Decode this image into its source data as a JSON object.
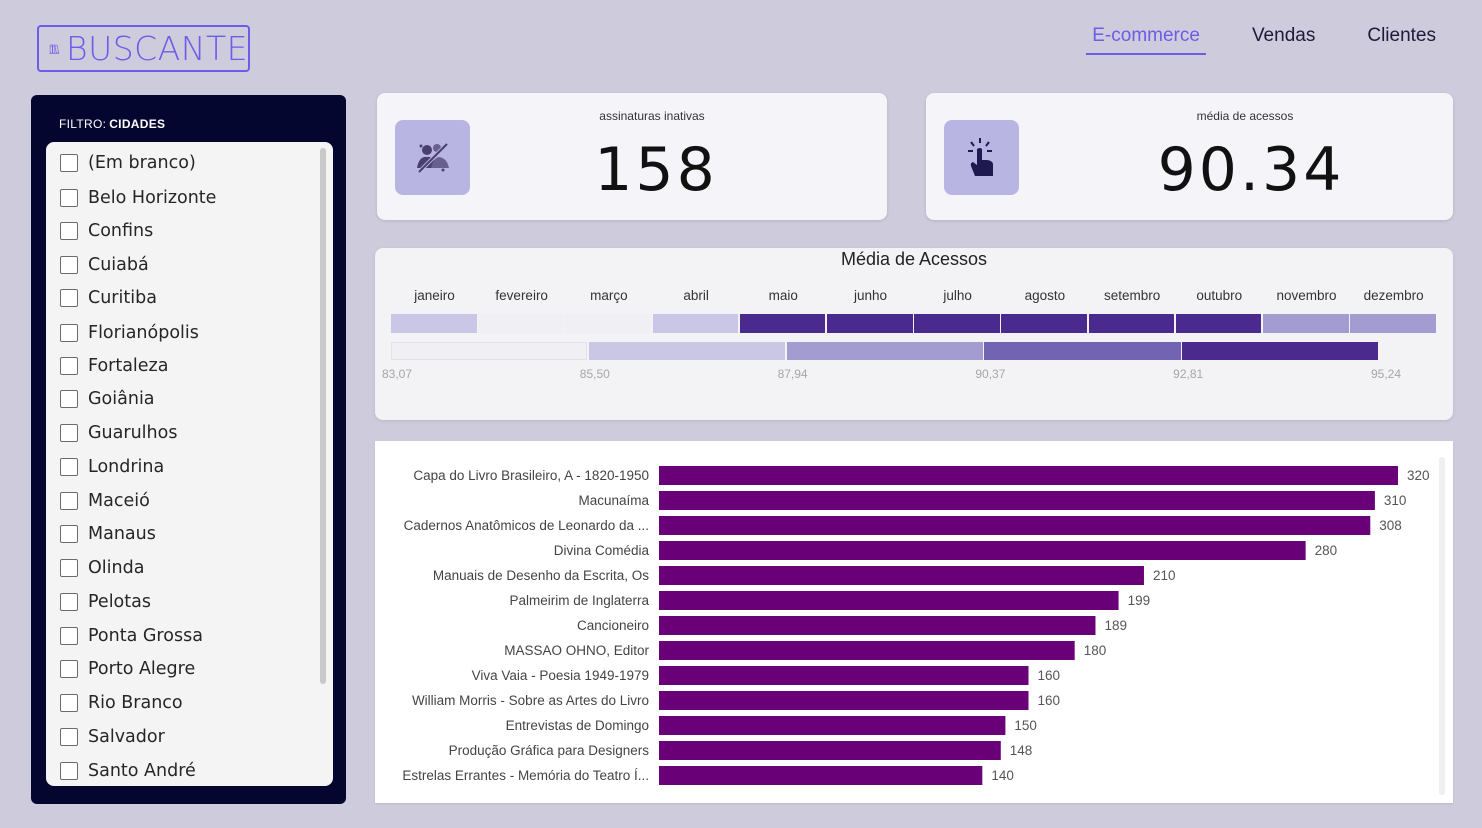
{
  "logo": {
    "text": "BUSCANTE",
    "icon": "books-icon"
  },
  "nav": {
    "items": [
      {
        "label": "E-commerce",
        "active": true
      },
      {
        "label": "Vendas",
        "active": false
      },
      {
        "label": "Clientes",
        "active": false
      }
    ]
  },
  "filter": {
    "prefix": "FILTRO:",
    "name": "CIDADES",
    "items": [
      "(Em branco)",
      "Belo Horizonte",
      "Confins",
      "Cuiabá",
      "Curitiba",
      "Florianópolis",
      "Fortaleza",
      "Goiânia",
      "Guarulhos",
      "Londrina",
      "Maceió",
      "Manaus",
      "Olinda",
      "Pelotas",
      "Ponta Grossa",
      "Porto Alegre",
      "Rio Branco",
      "Salvador",
      "Santo André"
    ]
  },
  "kpis": [
    {
      "label": "assinaturas inativas",
      "value": "158",
      "icon": "inactive-subscription-icon"
    },
    {
      "label": "média de acessos",
      "value": "90.34",
      "icon": "pointer-click-icon"
    }
  ],
  "heatmap": {
    "title": "Média de Acessos",
    "months": [
      "janeiro",
      "fevereiro",
      "março",
      "abril",
      "maio",
      "junho",
      "julho",
      "agosto",
      "setembro",
      "outubro",
      "novembro",
      "dezembro"
    ],
    "month_colors": [
      "#cac6e6",
      "#efeff4",
      "#efeff4",
      "#cac6e6",
      "#4a2a8f",
      "#4a2a8f",
      "#4a2a8f",
      "#4a2a8f",
      "#4a2a8f",
      "#4a2a8f",
      "#a39cd0",
      "#a39cd0"
    ],
    "legend_colors": [
      "#efeff4",
      "#cac6e6",
      "#a39cd0",
      "#7263b3",
      "#4a2a8f"
    ],
    "legend_labels": [
      "83,07",
      "85,50",
      "87,94",
      "90,37",
      "92,81",
      "95,24"
    ]
  },
  "chart_data": {
    "type": "bar",
    "orientation": "horizontal",
    "categories": [
      "Capa do Livro Brasileiro, A - 1820-1950",
      "Macunaíma",
      "Cadernos Anatômicos de Leonardo da ...",
      "Divina Comédia",
      "Manuais de Desenho da Escrita, Os",
      "Palmeirim de Inglaterra",
      "Cancioneiro",
      "MASSAO OHNO, Editor",
      "Viva Vaia - Poesia 1949-1979",
      "William Morris - Sobre as Artes do Livro",
      "Entrevistas de Domingo",
      "Produção Gráfica para Designers",
      "Estrelas Errantes - Memória do Teatro Í..."
    ],
    "values": [
      320,
      310,
      308,
      280,
      210,
      199,
      189,
      180,
      160,
      160,
      150,
      148,
      140
    ],
    "color": "#6a0077",
    "xlim": [
      0,
      320
    ]
  }
}
